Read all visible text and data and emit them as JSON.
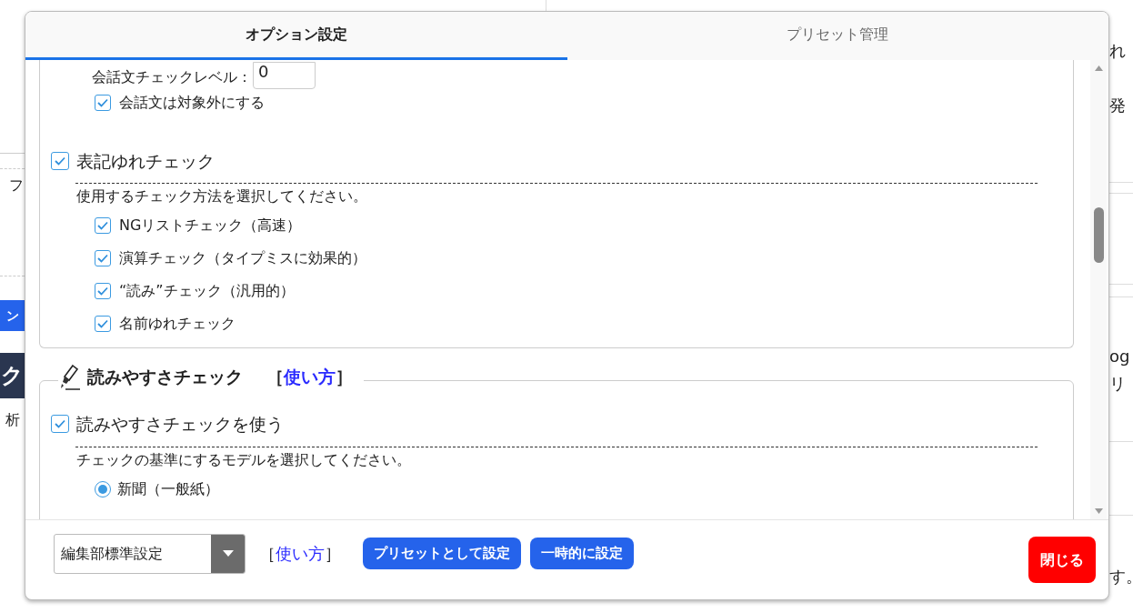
{
  "background": {
    "right_fragments": [
      {
        "text": "れ"
      },
      {
        "text": "発"
      },
      {
        "text": "og"
      },
      {
        "text": "リ"
      },
      {
        "text": "す。"
      }
    ],
    "left_fragments": [
      {
        "kind": "text",
        "text": "フ"
      },
      {
        "kind": "button",
        "text": "ン"
      },
      {
        "kind": "banner",
        "text": "ク"
      },
      {
        "kind": "text",
        "text": "析"
      }
    ]
  },
  "dialog": {
    "tabs": [
      {
        "label": "オプション設定",
        "selected": true
      },
      {
        "label": "プリセット管理",
        "selected": false
      }
    ],
    "level_field": {
      "label": "会話文チェックレベル：",
      "value": "0"
    },
    "exclude_dialogue": {
      "label": "会話文は対象外にする",
      "checked": true
    },
    "variation": {
      "label": "表記ゆれチェック",
      "checked": true,
      "instruction": "使用するチェック方法を選択してください。",
      "methods": [
        {
          "label": "NGリストチェック（高速）",
          "checked": true
        },
        {
          "label": "演算チェック（タイプミスに効果的）",
          "checked": true
        },
        {
          "label": "“読み”チェック（汎用的）",
          "checked": true
        },
        {
          "label": "名前ゆれチェック",
          "checked": true
        }
      ]
    },
    "readability": {
      "title": "読みやすさチェック",
      "help_open": "［",
      "help_link": "使い方",
      "help_close": "］",
      "use": {
        "label": "読みやすさチェックを使う",
        "checked": true
      },
      "instruction": "チェックの基準にするモデルを選択してください。",
      "models": [
        {
          "label": "新聞（一般紙）",
          "selected": true
        }
      ]
    },
    "footer": {
      "preset": "編集部標準設定",
      "help_open": "［",
      "help_link": "使い方",
      "help_close": "］",
      "buttons": [
        "プリセットとして設定",
        "一時的に設定"
      ],
      "close": "閉じる"
    }
  }
}
